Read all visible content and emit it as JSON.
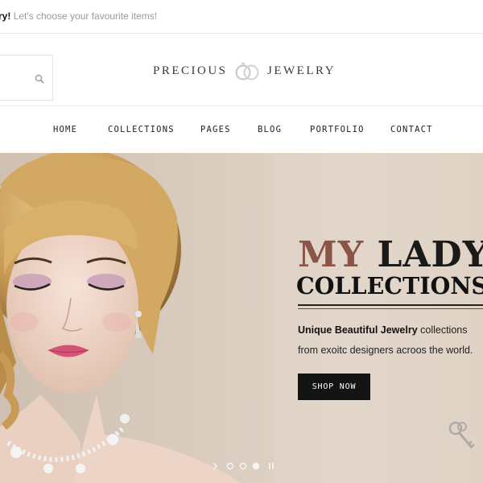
{
  "topbar": {
    "strong_text": "ry!",
    "message": "Let's choose your favourite items!"
  },
  "header": {
    "search_icon": "search-icon",
    "logo_word_1": "PRECIOUS",
    "logo_word_2": "JEWELRY",
    "logo_icon": "rings-icon"
  },
  "nav": {
    "items": [
      "HOME",
      "COLLECTIONS",
      "PAGES",
      "BLOG",
      "PORTFOLIO",
      "CONTACT"
    ]
  },
  "hero": {
    "headline_accent": "MY",
    "headline_dark": "LADY",
    "headline_sub": "COLLECTIONS",
    "desc_bold": "Unique Beautiful Jewelry",
    "desc_rest": " collections",
    "desc_line2": "from exoitc designers acroos the world.",
    "cta_label": "SHOP NOW",
    "slide_count": 3,
    "active_slide": 1
  },
  "colors": {
    "accent": "#8a5546",
    "dark": "#141414",
    "hero_bg": "#ddd0c3",
    "muted_text": "#9a9a9a"
  }
}
